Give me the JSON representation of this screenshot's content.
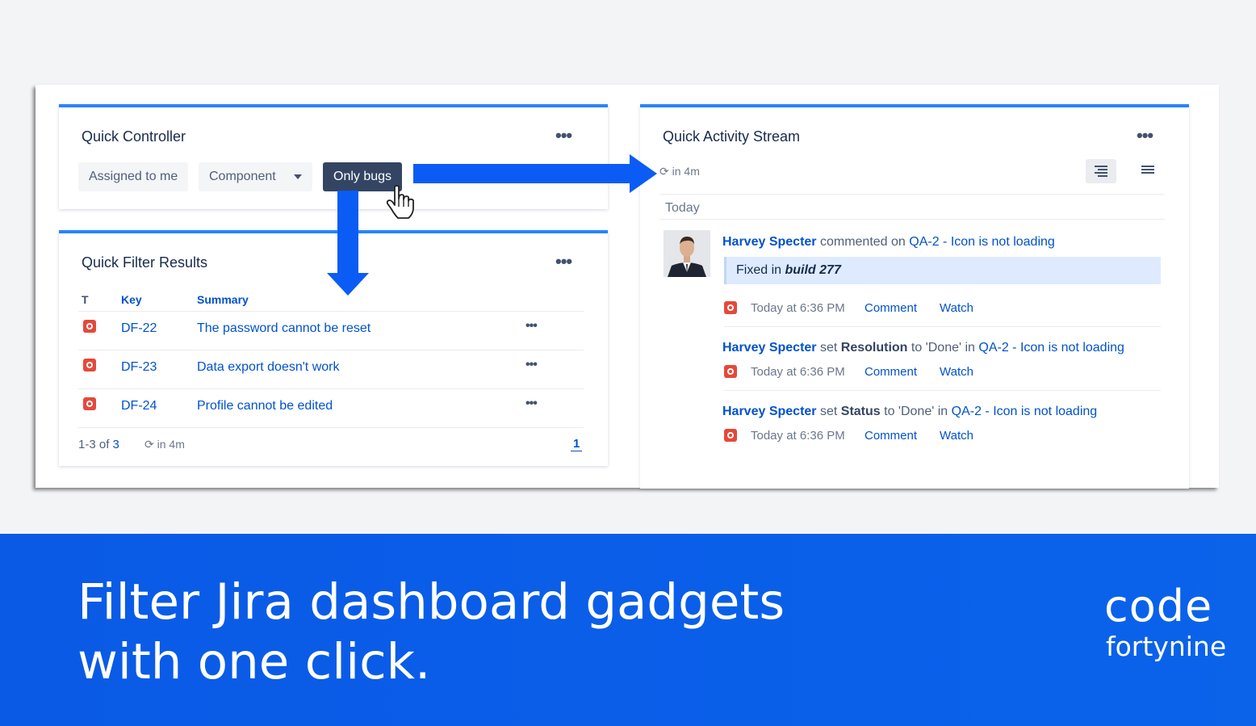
{
  "quick_controller": {
    "title": "Quick Controller",
    "buttons": [
      "Assigned to me",
      "Component",
      "Only bugs"
    ]
  },
  "quick_filter": {
    "title": "Quick Filter Results",
    "headers": [
      "T",
      "Key",
      "Summary"
    ],
    "rows": [
      {
        "key": "DF-22",
        "summary": "The password cannot be reset"
      },
      {
        "key": "DF-23",
        "summary": "Data export doesn't work"
      },
      {
        "key": "DF-24",
        "summary": "Profile cannot be edited"
      }
    ],
    "range": "1-3 of",
    "total": "3",
    "refresh": "in 4m",
    "page": "1"
  },
  "activity": {
    "title": "Quick Activity Stream",
    "refresh": "in 4m",
    "section": "Today",
    "items": [
      {
        "who": "Harvey Specter",
        "verb": "commented on",
        "issue": "QA-2 - Icon is not loading",
        "quote_pre": "Fixed in",
        "quote_em": "build 277",
        "time": "Today at 6:36 PM",
        "comment": "Comment",
        "watch": "Watch"
      },
      {
        "who": "Harvey Specter",
        "verb": "set",
        "field": "Resolution",
        "mid": "to 'Done' in",
        "issue": "QA-2 - Icon is not loading",
        "time": "Today at 6:36 PM",
        "comment": "Comment",
        "watch": "Watch"
      },
      {
        "who": "Harvey Specter",
        "verb": "set",
        "field": "Status",
        "mid": "to 'Done' in",
        "issue": "QA-2 - Icon is not loading",
        "time": "Today at 6:36 PM",
        "comment": "Comment",
        "watch": "Watch"
      }
    ]
  },
  "banner": {
    "line1": "Filter Jira dashboard gadgets",
    "line2": "with one click.",
    "brand_top": "code",
    "brand_bottom": "fortynine"
  },
  "colors": {
    "accent": "#2684ff",
    "link": "#0052cc",
    "bug": "#e5493a",
    "banner": "#0a5ae6"
  }
}
